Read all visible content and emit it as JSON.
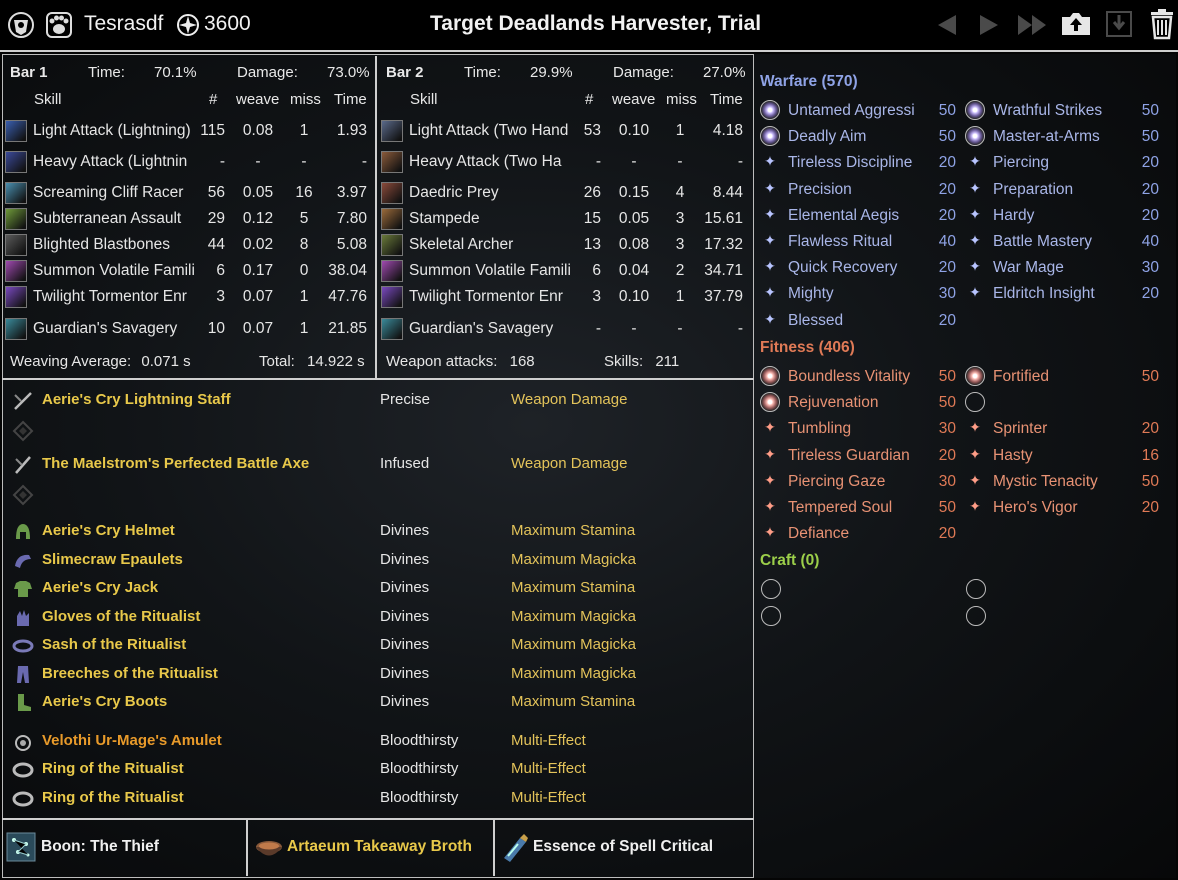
{
  "header": {
    "player": "Tesrasdf",
    "cp": "3600",
    "title": "Target Deadlands Harvester, Trial"
  },
  "bar1": {
    "label": "Bar 1",
    "time_label": "Time:",
    "time": "70.1%",
    "damage_label": "Damage:",
    "damage": "73.0%",
    "col_skill": "Skill",
    "col_num": "#",
    "col_weave": "weave",
    "col_miss": "miss",
    "col_time": "Time",
    "rows": [
      {
        "name": "Light Attack (Lightning)",
        "n": "115",
        "weave": "0.08",
        "miss": "1",
        "time": "1.93",
        "color": "#3a5fb0"
      },
      {
        "name": "Heavy Attack (Lightnin",
        "n": "-",
        "weave": "-",
        "miss": "-",
        "time": "-",
        "color": "#3b4a9a"
      },
      {
        "name": "Screaming Cliff Racer",
        "n": "56",
        "weave": "0.05",
        "miss": "16",
        "time": "3.97",
        "color": "#4a8fb0"
      },
      {
        "name": "Subterranean Assault",
        "n": "29",
        "weave": "0.12",
        "miss": "5",
        "time": "7.80",
        "color": "#6f9a3a"
      },
      {
        "name": "Blighted Blastbones",
        "n": "44",
        "weave": "0.02",
        "miss": "8",
        "time": "5.08",
        "color": "#5a5a5a"
      },
      {
        "name": "Summon Volatile Famili",
        "n": "6",
        "weave": "0.17",
        "miss": "0",
        "time": "38.04",
        "color": "#a04ab0"
      },
      {
        "name": "Twilight Tormentor Enr",
        "n": "3",
        "weave": "0.07",
        "miss": "1",
        "time": "47.76",
        "color": "#7a4ac0"
      },
      {
        "name": "Guardian's Savagery",
        "n": "10",
        "weave": "0.07",
        "miss": "1",
        "time": "21.85",
        "color": "#3a8a9a"
      }
    ],
    "weaving_label": "Weaving Average:",
    "weaving": "0.071 s",
    "total_label": "Total:",
    "total": "14.922 s"
  },
  "bar2": {
    "label": "Bar 2",
    "time_label": "Time:",
    "time": "29.9%",
    "damage_label": "Damage:",
    "damage": "27.0%",
    "col_skill": "Skill",
    "col_num": "#",
    "col_weave": "weave",
    "col_miss": "miss",
    "col_time": "Time",
    "rows": [
      {
        "name": "Light Attack (Two Hand",
        "n": "53",
        "weave": "0.10",
        "miss": "1",
        "time": "4.18",
        "color": "#5a6a8a"
      },
      {
        "name": "Heavy Attack (Two Ha",
        "n": "-",
        "weave": "-",
        "miss": "-",
        "time": "-",
        "color": "#8a5a3a"
      },
      {
        "name": "Daedric Prey",
        "n": "26",
        "weave": "0.15",
        "miss": "4",
        "time": "8.44",
        "color": "#8a4a3a"
      },
      {
        "name": "Stampede",
        "n": "15",
        "weave": "0.05",
        "miss": "3",
        "time": "15.61",
        "color": "#9a6a3a"
      },
      {
        "name": "Skeletal Archer",
        "n": "13",
        "weave": "0.08",
        "miss": "3",
        "time": "17.32",
        "color": "#6a7a3a"
      },
      {
        "name": "Summon Volatile Famili",
        "n": "6",
        "weave": "0.04",
        "miss": "2",
        "time": "34.71",
        "color": "#a04ab0"
      },
      {
        "name": "Twilight Tormentor Enr",
        "n": "3",
        "weave": "0.10",
        "miss": "1",
        "time": "37.79",
        "color": "#7a4ac0"
      },
      {
        "name": "Guardian's Savagery",
        "n": "-",
        "weave": "-",
        "miss": "-",
        "time": "-",
        "color": "#3a8a9a"
      }
    ],
    "weapon_label": "Weapon attacks:",
    "weapon": "168",
    "skills_label": "Skills:",
    "skills": "211"
  },
  "gear": [
    {
      "name": "Aerie's Cry Lightning Staff",
      "trait": "Precise",
      "ench": "Weapon Damage",
      "icon": "staff-icon",
      "quality": "gold"
    },
    {
      "name": "The Maelstrom's Perfected Battle Axe",
      "trait": "Infused",
      "ench": "Weapon Damage",
      "icon": "axe-icon",
      "quality": "gold"
    },
    {
      "name": "Aerie's Cry Helmet",
      "trait": "Divines",
      "ench": "Maximum Stamina",
      "icon": "helmet-icon",
      "quality": "gold"
    },
    {
      "name": "Slimecraw Epaulets",
      "trait": "Divines",
      "ench": "Maximum Magicka",
      "icon": "shoulder-icon",
      "quality": "gold"
    },
    {
      "name": "Aerie's Cry Jack",
      "trait": "Divines",
      "ench": "Maximum Stamina",
      "icon": "chest-icon",
      "quality": "gold"
    },
    {
      "name": "Gloves of the Ritualist",
      "trait": "Divines",
      "ench": "Maximum Magicka",
      "icon": "gloves-icon",
      "quality": "gold"
    },
    {
      "name": "Sash of the Ritualist",
      "trait": "Divines",
      "ench": "Maximum Magicka",
      "icon": "belt-icon",
      "quality": "gold"
    },
    {
      "name": "Breeches of the Ritualist",
      "trait": "Divines",
      "ench": "Maximum Magicka",
      "icon": "legs-icon",
      "quality": "gold"
    },
    {
      "name": "Aerie's Cry Boots",
      "trait": "Divines",
      "ench": "Maximum Stamina",
      "icon": "boots-icon",
      "quality": "gold"
    },
    {
      "name": "Velothi Ur-Mage's Amulet",
      "trait": "Bloodthirsty",
      "ench": "Multi-Effect",
      "icon": "amulet-icon",
      "quality": "orange"
    },
    {
      "name": "Ring of the Ritualist",
      "trait": "Bloodthirsty",
      "ench": "Multi-Effect",
      "icon": "ring-icon",
      "quality": "gold"
    },
    {
      "name": "Ring of the Ritualist",
      "trait": "Bloodthirsty",
      "ench": "Multi-Effect",
      "icon": "ring-icon",
      "quality": "gold"
    }
  ],
  "footer": {
    "boon": "Boon: The Thief",
    "food": "Artaeum Takeaway Broth",
    "potion": "Essence of Spell Critical"
  },
  "champion": {
    "warfare_title": "Warfare (570)",
    "warfare_left": [
      {
        "name": "Untamed Aggressi",
        "val": "50",
        "slot": true
      },
      {
        "name": "Deadly Aim",
        "val": "50",
        "slot": true
      },
      {
        "name": "Tireless Discipline",
        "val": "20"
      },
      {
        "name": "Precision",
        "val": "20"
      },
      {
        "name": "Elemental Aegis",
        "val": "20"
      },
      {
        "name": "Flawless Ritual",
        "val": "40"
      },
      {
        "name": "Quick Recovery",
        "val": "20"
      },
      {
        "name": "Mighty",
        "val": "30"
      },
      {
        "name": "Blessed",
        "val": "20"
      }
    ],
    "warfare_right": [
      {
        "name": "Wrathful Strikes",
        "val": "50",
        "slot": true
      },
      {
        "name": "Master-at-Arms",
        "val": "50",
        "slot": true
      },
      {
        "name": "Piercing",
        "val": "20"
      },
      {
        "name": "Preparation",
        "val": "20"
      },
      {
        "name": "Hardy",
        "val": "20"
      },
      {
        "name": "Battle Mastery",
        "val": "40"
      },
      {
        "name": "War Mage",
        "val": "30"
      },
      {
        "name": "Eldritch Insight",
        "val": "20"
      }
    ],
    "fitness_title": "Fitness (406)",
    "fitness_left": [
      {
        "name": "Boundless Vitality",
        "val": "50",
        "slot": true
      },
      {
        "name": "Rejuvenation",
        "val": "50",
        "slot": true
      },
      {
        "name": "Tumbling",
        "val": "30"
      },
      {
        "name": "Tireless Guardian",
        "val": "20"
      },
      {
        "name": "Piercing Gaze",
        "val": "30"
      },
      {
        "name": "Tempered Soul",
        "val": "50"
      },
      {
        "name": "Defiance",
        "val": "20"
      }
    ],
    "fitness_right": [
      {
        "name": "Fortified",
        "val": "50",
        "slot": true
      },
      {
        "name": "",
        "val": "",
        "slot": "empty"
      },
      {
        "name": "Sprinter",
        "val": "20"
      },
      {
        "name": "Hasty",
        "val": "16"
      },
      {
        "name": "Mystic Tenacity",
        "val": "50"
      },
      {
        "name": "Hero's Vigor",
        "val": "20"
      }
    ],
    "craft_title": "Craft (0)"
  },
  "colors": {
    "warfare": "#8fa3e6",
    "fitness": "#e07a56",
    "craft": "#9ccf4a",
    "gold": "#e8c84a",
    "orange": "#e89a2a"
  }
}
